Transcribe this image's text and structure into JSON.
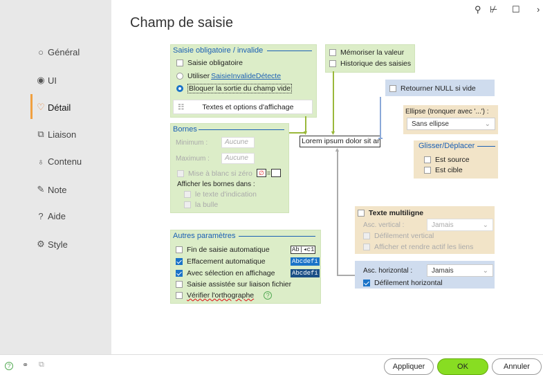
{
  "window": {
    "title": "Champ de saisie",
    "search_icon": "⚲",
    "pin_icon": "⊬",
    "max_icon": "☐",
    "close_icon": "›"
  },
  "sidebar": {
    "items": [
      {
        "label": "Général",
        "icon": "○"
      },
      {
        "label": "UI",
        "icon": "◉"
      },
      {
        "label": "Détail",
        "icon": "♡"
      },
      {
        "label": "Liaison",
        "icon": "⧉"
      },
      {
        "label": "Contenu",
        "icon": "♁"
      },
      {
        "label": "Note",
        "icon": "✎"
      },
      {
        "label": "Aide",
        "icon": "?"
      },
      {
        "label": "Style",
        "icon": "⚙"
      }
    ],
    "selected": "Détail"
  },
  "saisie": {
    "title": "Saisie obligatoire / invalide",
    "obligatoire": "Saisie obligatoire",
    "utiliser": "Utiliser",
    "utiliser_link": "SaisieInvalideDétecte",
    "bloquer": "Bloquer la sortie du champ vide",
    "textes_button": "Textes et options d'affichage"
  },
  "memo": {
    "memoriser": "Mémoriser la valeur",
    "historique": "Historique des saisies"
  },
  "null": {
    "label": "Retourner NULL si vide"
  },
  "ellipse": {
    "label": "Ellipse (tronquer avec '...') :",
    "value": "Sans ellipse"
  },
  "glisser": {
    "title": "Glisser/Déplacer",
    "source": "Est source",
    "cible": "Est cible"
  },
  "preview": {
    "text": "Lorem ipsum dolor sit amet,"
  },
  "bornes": {
    "title": "Bornes",
    "minimum": "Minimum :",
    "maximum": "Maximum :",
    "min_placeholder": "Aucune",
    "max_placeholder": "Aucune",
    "blanc": "Mise à blanc si zéro",
    "blanc_sample": "=",
    "afficher": "Afficher les bornes dans :",
    "indication": "le texte d'indication",
    "bulle": "la bulle"
  },
  "autres": {
    "title": "Autres paramètres",
    "items": [
      {
        "label": "Fin de saisie automatique",
        "checked": false,
        "sample": "Ab|◂c1"
      },
      {
        "label": "Effacement automatique",
        "checked": true,
        "sample": "Abcdefi"
      },
      {
        "label": "Avec sélection en affichage",
        "checked": true,
        "sample": "Abcdefi"
      },
      {
        "label": "Saisie assistée sur liaison fichier",
        "checked": false,
        "sample": ""
      },
      {
        "label": "Vérifier l'orthographe",
        "checked": false,
        "sample": ""
      }
    ]
  },
  "multiligne": {
    "title": "Texte multiligne",
    "asc_vertical": "Asc. vertical :",
    "asc_vertical_value": "Jamais",
    "defilement_vertical": "Défilement vertical",
    "afficher_liens": "Afficher et rendre actif les liens",
    "asc_horizontal": "Asc. horizontal :",
    "asc_horizontal_value": "Jamais",
    "defilement_horizontal": "Défilement horizontal"
  },
  "footer": {
    "appliquer": "Appliquer",
    "ok": "OK",
    "annuler": "Annuler"
  },
  "colors": {
    "accent": "#1a5fb4",
    "green_panel": "#dcedc8",
    "blue_panel": "#cfdcee",
    "orange_panel": "#f2e4c8",
    "ok": "#88dd22"
  }
}
